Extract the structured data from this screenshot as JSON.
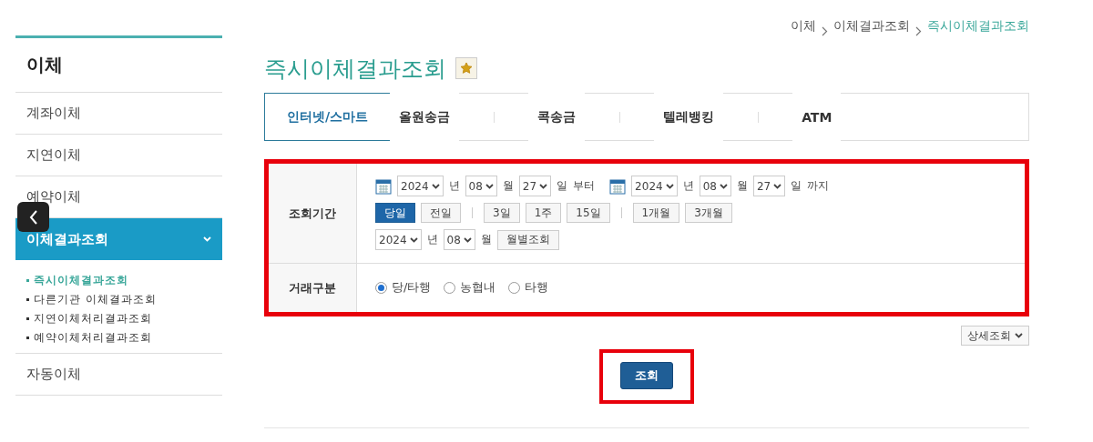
{
  "breadcrumb": [
    "이체",
    "이체결과조회",
    "즉시이체결과조회"
  ],
  "sidebar": {
    "title": "이체",
    "items": [
      {
        "label": "계좌이체",
        "selected": false
      },
      {
        "label": "지연이체",
        "selected": false
      },
      {
        "label": "예약이체",
        "selected": false
      },
      {
        "label": "이체결과조회",
        "selected": true,
        "expanded": true,
        "children": [
          {
            "label": "즉시이체결과조회",
            "selected": true
          },
          {
            "label": "다른기관 이체결과조회",
            "selected": false
          },
          {
            "label": "지연이체처리결과조회",
            "selected": false
          },
          {
            "label": "예약이체처리결과조회",
            "selected": false
          }
        ]
      },
      {
        "label": "자동이체",
        "selected": false
      }
    ]
  },
  "page_title": "즉시이체결과조회",
  "favorite": {
    "on": true
  },
  "tabs": [
    {
      "label": "인터넷/스마트",
      "selected": true
    },
    {
      "label": "올원송금",
      "selected": false
    },
    {
      "label": "콕송금",
      "selected": false
    },
    {
      "label": "텔레뱅킹",
      "selected": false
    },
    {
      "label": "ATM",
      "selected": false
    }
  ],
  "form": {
    "highlighted": true,
    "period": {
      "label": "조회기간",
      "from": {
        "year": "2024",
        "year_unit": "년",
        "month": "08",
        "month_unit": "월",
        "day": "27",
        "day_unit": "일",
        "suffix": "부터"
      },
      "to": {
        "year": "2024",
        "year_unit": "년",
        "month": "08",
        "month_unit": "월",
        "day": "27",
        "day_unit": "일",
        "suffix": "까지"
      },
      "quick_groups": [
        [
          {
            "label": "당일",
            "selected": true
          },
          {
            "label": "전일",
            "selected": false
          }
        ],
        [
          {
            "label": "3일",
            "selected": false
          },
          {
            "label": "1주",
            "selected": false
          },
          {
            "label": "15일",
            "selected": false
          }
        ],
        [
          {
            "label": "1개월",
            "selected": false
          },
          {
            "label": "3개월",
            "selected": false
          }
        ]
      ],
      "monthly": {
        "year": "2024",
        "year_unit": "년",
        "month": "08",
        "month_unit": "월",
        "button": "월별조회"
      }
    },
    "type": {
      "label": "거래구분",
      "options": [
        {
          "label": "당/타행",
          "selected": true
        },
        {
          "label": "농협내",
          "selected": false
        },
        {
          "label": "타행",
          "selected": false
        }
      ]
    }
  },
  "detail_button": "상세조회",
  "search_button": {
    "label": "조회",
    "highlighted": true
  }
}
